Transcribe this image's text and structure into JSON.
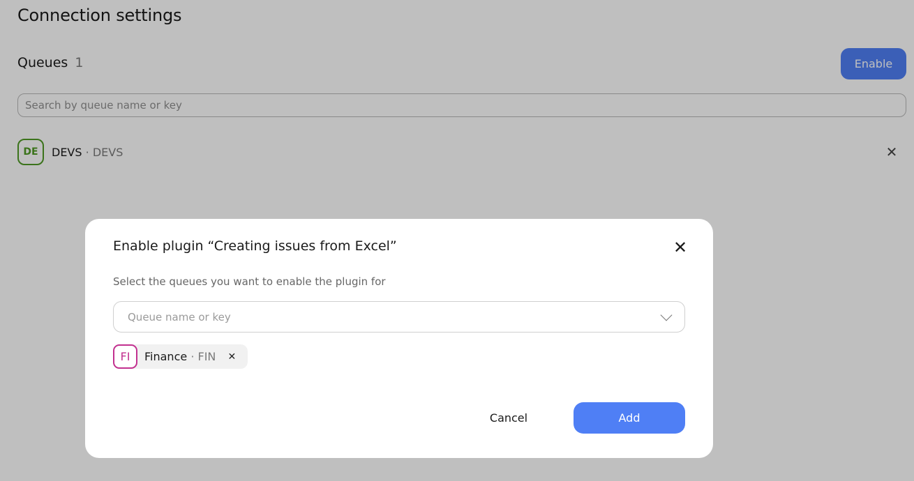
{
  "page": {
    "title": "Connection settings",
    "queues_label": "Queues",
    "queues_count": "1",
    "enable_label": "Enable",
    "search_placeholder": "Search by queue name or key",
    "queues": [
      {
        "avatar": "DE",
        "name": "DEVS",
        "separator": "·",
        "key": "DEVS",
        "avatar_color": "#4f9a24"
      }
    ]
  },
  "modal": {
    "title": "Enable plugin “Creating issues from Excel”",
    "subtitle": "Select the queues you want to enable the plugin for",
    "select_placeholder": "Queue name or key",
    "selected": [
      {
        "avatar": "FI",
        "name": "Finance",
        "separator": "·",
        "key": "FIN",
        "avatar_color": "#c2308f"
      }
    ],
    "cancel_label": "Cancel",
    "add_label": "Add"
  },
  "icons": {
    "close": "close-icon",
    "chevron": "chevron-down-icon",
    "remove": "remove-chip-icon"
  },
  "colors": {
    "accent": "#4f7ff5",
    "overlay": "rgba(0,0,0,0.25)"
  }
}
